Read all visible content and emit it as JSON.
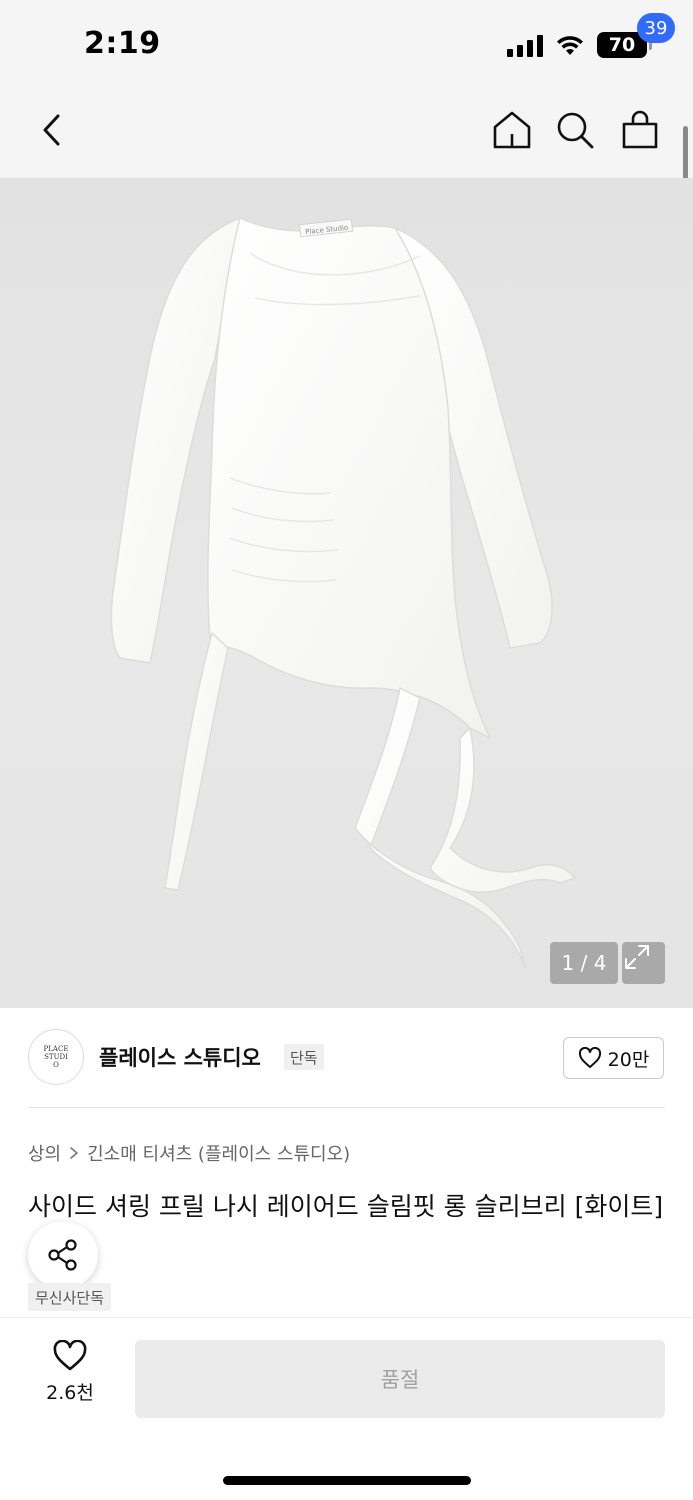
{
  "status": {
    "time": "2:19",
    "battery": "70"
  },
  "nav": {
    "cart_count": "39",
    "icons": [
      "chevron-left-icon",
      "home-icon",
      "search-icon",
      "cart-icon"
    ]
  },
  "gallery": {
    "counter": "1 / 4",
    "current": 1,
    "total": 4,
    "garment_label": "Place Studio"
  },
  "brand": {
    "logo_text": "PLACE STUDIO",
    "name": "플레이스 스튜디오",
    "tag": "단독",
    "like_count": "20만"
  },
  "product": {
    "breadcrumb": [
      "상의",
      "긴소매 티셔츠 (플레이스 스튜디오)"
    ],
    "title": "사이드 셔링 프릴 나시 레이어드 슬림핏 롱 슬리브리 [화이트]",
    "badge": "무신사단독"
  },
  "bottom": {
    "wish_count": "2.6천",
    "buy_label": "품절"
  },
  "colors": {
    "badge_blue": "#2f6bff",
    "soldout_bg": "#ebebeb",
    "soldout_text": "#a0a0a0"
  }
}
